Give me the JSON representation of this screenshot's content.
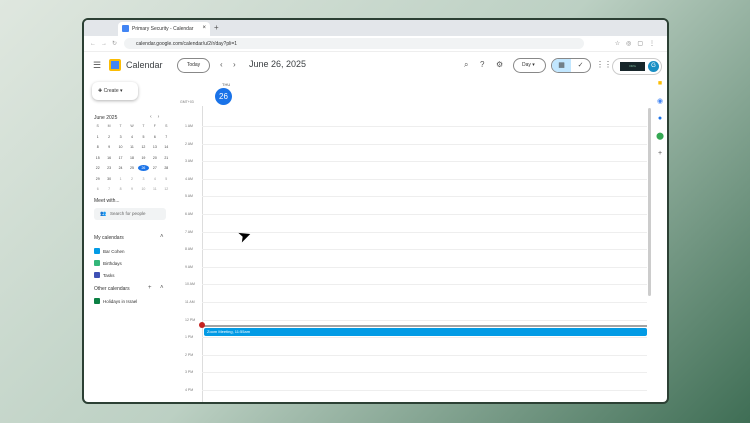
{
  "browser": {
    "tab_title": "Primary Security - Calendar",
    "url": "calendar.google.com/calendar/u/2/r/day?pli=1"
  },
  "header": {
    "app_title": "Calendar",
    "today_label": "Today",
    "date": "June 26, 2025",
    "view_label": "Day",
    "avatar_initial": "G",
    "org_label": "ORG"
  },
  "sidebar": {
    "create_label": "Create",
    "mini_cal": {
      "title": "June 2025",
      "weekdays": [
        "S",
        "M",
        "T",
        "W",
        "T",
        "F",
        "S"
      ],
      "days": [
        "1",
        "2",
        "3",
        "4",
        "5",
        "6",
        "7",
        "8",
        "9",
        "10",
        "11",
        "12",
        "13",
        "14",
        "15",
        "16",
        "17",
        "18",
        "19",
        "20",
        "21",
        "22",
        "23",
        "24",
        "25",
        "26",
        "27",
        "28",
        "29",
        "30",
        "1",
        "2",
        "3",
        "4",
        "5",
        "6",
        "7",
        "8",
        "9",
        "10",
        "11",
        "12"
      ]
    },
    "meet_with": "Meet with...",
    "search_placeholder": "Search for people",
    "my_calendars": "My calendars",
    "my_cal_items": [
      {
        "label": "Bar Cohen",
        "color": "#039be5"
      },
      {
        "label": "Birthdays",
        "color": "#33b679"
      },
      {
        "label": "Tasks",
        "color": "#3f51b5"
      }
    ],
    "other_calendars": "Other calendars",
    "other_cal_items": [
      {
        "label": "Holidays in Israel",
        "color": "#0b8043"
      }
    ]
  },
  "day": {
    "weekday": "THU",
    "number": "26",
    "timezone": "GMT+03",
    "hours": [
      "1 AM",
      "2 AM",
      "3 AM",
      "4 AM",
      "5 AM",
      "6 AM",
      "7 AM",
      "8 AM",
      "9 AM",
      "10 AM",
      "11 AM",
      "12 PM",
      "1 PM",
      "2 PM",
      "3 PM",
      "4 PM"
    ],
    "event": {
      "title": "Zoom Meeting, 11:55am",
      "color": "#039be5"
    }
  }
}
